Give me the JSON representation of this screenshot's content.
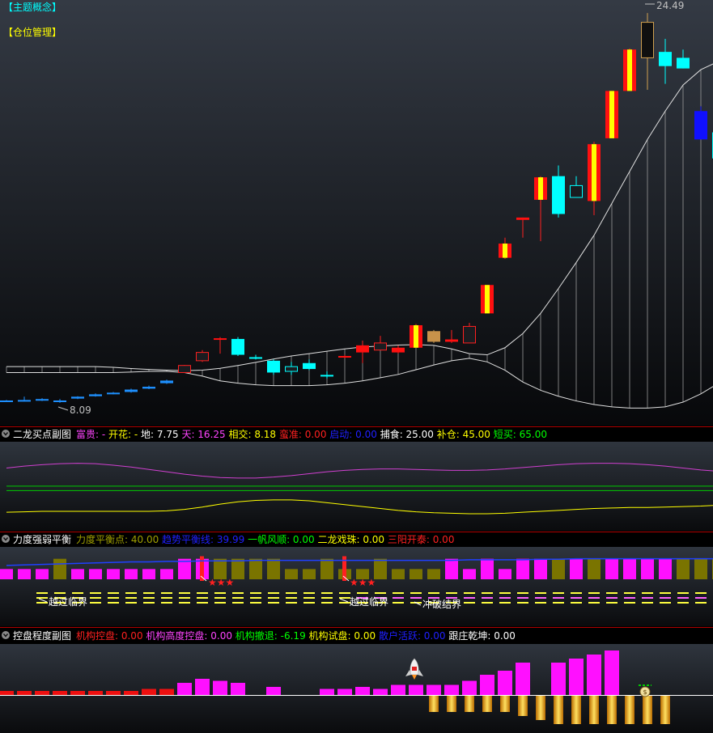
{
  "main": {
    "tag1": "【主题概念】",
    "tag2": "【仓位管理】",
    "high_label": "24.49",
    "low_label": "8.09"
  },
  "panel1": {
    "title": "二龙买点副图",
    "items": [
      {
        "label": "富贵: -",
        "color": "#ff44ff"
      },
      {
        "label": "开花: -",
        "color": "#ffff00"
      },
      {
        "label": "地: 7.75",
        "color": "#ffffff"
      },
      {
        "label": "天: 16.25",
        "color": "#ff44ff"
      },
      {
        "label": "相交: 8.18",
        "color": "#ffff00"
      },
      {
        "label": "蛮准: 0.00",
        "color": "#ff2020"
      },
      {
        "label": "启动: 0.00",
        "color": "#2020ff"
      },
      {
        "label": "捕食: 25.00",
        "color": "#ffffff"
      },
      {
        "label": "补仓: 45.00",
        "color": "#ffff00"
      },
      {
        "label": "短买: 65.00",
        "color": "#00ff00"
      }
    ]
  },
  "panel2": {
    "title": "力度强弱平衡",
    "items": [
      {
        "label": "力度平衡点: 40.00",
        "color": "#a0a000"
      },
      {
        "label": "趋势平衡线: 39.99",
        "color": "#2020ff"
      },
      {
        "label": "一帆风顺: 0.00",
        "color": "#00ff00"
      },
      {
        "label": "二龙戏珠: 0.00",
        "color": "#ffff00"
      },
      {
        "label": "三阳开泰: 0.00",
        "color": "#ff2020"
      }
    ],
    "annotations": [
      "越过临界",
      "越过临界",
      "冲破结界"
    ],
    "stars": "★★★"
  },
  "panel3": {
    "title": "控盘程度副图",
    "items": [
      {
        "label": "机构控盘: 0.00",
        "color": "#ff2020"
      },
      {
        "label": "机构高度控盘: 0.00",
        "color": "#ff44ff"
      },
      {
        "label": "机构撤退: -6.19",
        "color": "#00ff00"
      },
      {
        "label": "机构试盘: 0.00",
        "color": "#ffff00"
      },
      {
        "label": "散户活跃: 0.00",
        "color": "#2020ff"
      },
      {
        "label": "跟庄乾坤: 0.00",
        "color": "#ffffff"
      }
    ]
  },
  "chart_data": [
    {
      "type": "candlestick",
      "candles": [
        {
          "o": 8.12,
          "c": 8.1,
          "h": 8.14,
          "l": 8.06,
          "t": "dn"
        },
        {
          "o": 8.14,
          "c": 8.12,
          "h": 8.28,
          "l": 8.08,
          "t": "dn"
        },
        {
          "o": 8.15,
          "c": 8.18,
          "h": 8.22,
          "l": 8.1,
          "t": "dn"
        },
        {
          "o": 8.12,
          "c": 8.1,
          "h": 8.18,
          "l": 8.02,
          "t": "dn"
        },
        {
          "o": 8.2,
          "c": 8.28,
          "h": 8.3,
          "l": 8.18,
          "t": "dn"
        },
        {
          "o": 8.3,
          "c": 8.38,
          "h": 8.42,
          "l": 8.28,
          "t": "dn"
        },
        {
          "o": 8.4,
          "c": 8.45,
          "h": 8.48,
          "l": 8.38,
          "t": "dn"
        },
        {
          "o": 8.48,
          "c": 8.58,
          "h": 8.62,
          "l": 8.45,
          "t": "dn"
        },
        {
          "o": 8.62,
          "c": 8.7,
          "h": 8.75,
          "l": 8.6,
          "t": "dn"
        },
        {
          "o": 8.85,
          "c": 8.96,
          "h": 9.0,
          "l": 8.82,
          "t": "dn"
        },
        {
          "o": 9.3,
          "c": 9.6,
          "h": 9.62,
          "l": 9.28,
          "t": "up"
        },
        {
          "o": 9.8,
          "c": 10.15,
          "h": 10.25,
          "l": 9.75,
          "t": "up"
        },
        {
          "o": 10.7,
          "c": 10.75,
          "h": 10.8,
          "l": 10.1,
          "t": "fill"
        },
        {
          "o": 10.72,
          "c": 10.05,
          "h": 10.8,
          "l": 10.0,
          "t": "cy"
        },
        {
          "o": 9.95,
          "c": 9.9,
          "h": 10.05,
          "l": 9.85,
          "t": "cy"
        },
        {
          "o": 9.8,
          "c": 9.3,
          "h": 9.85,
          "l": 9.2,
          "t": "cy"
        },
        {
          "o": 9.35,
          "c": 9.55,
          "h": 9.75,
          "l": 9.2,
          "t": "ucy"
        },
        {
          "o": 9.45,
          "c": 9.7,
          "h": 9.85,
          "l": 9.4,
          "t": "cy"
        },
        {
          "o": 9.15,
          "c": 9.2,
          "h": 9.35,
          "l": 9.05,
          "t": "cy"
        },
        {
          "o": 9.95,
          "c": 10.0,
          "h": 10.05,
          "l": 9.9,
          "t": "fill"
        },
        {
          "o": 10.15,
          "c": 10.45,
          "h": 10.65,
          "l": 9.7,
          "t": "fill"
        },
        {
          "o": 10.25,
          "c": 10.55,
          "h": 10.85,
          "l": 10.25,
          "t": "up"
        },
        {
          "o": 10.15,
          "c": 10.35,
          "h": 10.45,
          "l": 10.1,
          "t": "fill"
        },
        {
          "o": 10.35,
          "c": 11.3,
          "h": 11.35,
          "l": 10.35,
          "t": "rs"
        },
        {
          "o": 10.6,
          "c": 11.05,
          "h": 11.1,
          "l": 10.55,
          "t": "tan"
        },
        {
          "o": 10.6,
          "c": 10.7,
          "h": 11.1,
          "l": 10.55,
          "t": "fill"
        },
        {
          "o": 10.55,
          "c": 11.25,
          "h": 11.4,
          "l": 10.55,
          "t": "up"
        },
        {
          "o": 11.8,
          "c": 13.0,
          "h": 13.0,
          "l": 11.8,
          "t": "rs"
        },
        {
          "o": 14.15,
          "c": 14.75,
          "h": 15.0,
          "l": 14.1,
          "t": "rs"
        },
        {
          "o": 15.75,
          "c": 15.85,
          "h": 15.85,
          "l": 15.0,
          "t": "fill"
        },
        {
          "o": 16.6,
          "c": 17.55,
          "h": 17.6,
          "l": 14.85,
          "t": "rs"
        },
        {
          "o": 17.6,
          "c": 16.0,
          "h": 18.05,
          "l": 15.85,
          "t": "cy"
        },
        {
          "o": 16.7,
          "c": 17.2,
          "h": 17.6,
          "l": 16.7,
          "t": "ucy"
        },
        {
          "o": 16.55,
          "c": 18.95,
          "h": 19.05,
          "l": 15.95,
          "t": "rs"
        },
        {
          "o": 19.2,
          "c": 21.2,
          "h": 21.2,
          "l": 19.2,
          "t": "rs"
        },
        {
          "o": 21.2,
          "c": 22.95,
          "h": 23.0,
          "l": 21.2,
          "t": "rs"
        },
        {
          "o": 22.6,
          "c": 24.1,
          "h": 24.49,
          "l": 21.25,
          "t": "blk"
        },
        {
          "o": 22.85,
          "c": 22.25,
          "h": 23.4,
          "l": 21.5,
          "t": "cy"
        },
        {
          "o": 22.6,
          "c": 22.15,
          "h": 22.95,
          "l": 22.15,
          "t": "cy"
        },
        {
          "o": 20.35,
          "c": 19.15,
          "h": 20.55,
          "l": 19.15,
          "t": "bl"
        },
        {
          "o": 19.45,
          "c": 18.35,
          "h": 19.5,
          "l": 18.3,
          "t": "cy"
        }
      ],
      "band_upper": [
        9.55,
        9.55,
        9.55,
        9.55,
        9.55,
        9.55,
        9.52,
        9.47,
        9.43,
        9.4,
        9.38,
        9.4,
        9.48,
        9.6,
        9.73,
        9.87,
        10.0,
        10.1,
        10.2,
        10.3,
        10.38,
        10.42,
        10.46,
        10.48,
        10.45,
        10.3,
        10.1,
        10.05,
        10.35,
        10.95,
        11.8,
        12.85,
        13.95,
        15.1,
        16.45,
        17.8,
        19.15,
        20.35,
        21.45,
        22.1,
        22.45
      ],
      "band_lower": [
        9.3,
        9.3,
        9.3,
        9.3,
        9.3,
        9.3,
        9.3,
        9.32,
        9.35,
        9.35,
        9.3,
        9.15,
        8.95,
        8.85,
        8.78,
        8.75,
        8.75,
        8.75,
        8.78,
        8.85,
        8.95,
        9.08,
        9.22,
        9.42,
        9.62,
        9.8,
        9.9,
        9.75,
        9.4,
        8.9,
        8.55,
        8.3,
        8.1,
        7.95,
        7.85,
        7.8,
        7.8,
        7.85,
        8.05,
        8.4,
        8.85
      ]
    },
    {
      "type": "line",
      "series": [
        {
          "name": "天",
          "color": "#d040d0",
          "values": [
            12.5,
            12.9,
            13.2,
            13.4,
            13.5,
            13.4,
            13.1,
            12.7,
            12.2,
            11.7,
            11.2,
            10.8,
            10.5,
            10.4,
            10.4,
            10.6,
            10.9,
            11.3,
            11.7,
            12.0,
            12.2,
            12.3,
            12.3,
            12.2,
            12.1,
            12.0,
            12.0,
            12.1,
            12.3,
            12.6,
            12.9,
            13.2,
            13.4,
            13.5,
            13.5,
            13.4,
            13.2,
            12.9,
            12.5,
            12.1,
            11.8
          ]
        },
        {
          "name": "地",
          "color": "#ffff00",
          "values": [
            3.2,
            3.3,
            3.4,
            3.4,
            3.4,
            3.4,
            3.4,
            3.4,
            3.4,
            3.5,
            3.8,
            4.3,
            4.9,
            5.4,
            5.7,
            5.8,
            5.8,
            5.6,
            5.2,
            4.8,
            4.4,
            4.0,
            3.6,
            3.3,
            3.1,
            3.0,
            2.9,
            2.9,
            3.0,
            3.2,
            3.4,
            3.6,
            3.8,
            4.0,
            4.1,
            4.2,
            4.2,
            4.3,
            4.4,
            4.5,
            4.7
          ]
        }
      ],
      "hlines": [
        {
          "value": 8.7,
          "color": "#00cc00"
        },
        {
          "value": 7.75,
          "color": "#00cc00"
        }
      ],
      "ylim": [
        0,
        17
      ]
    },
    {
      "type": "bar",
      "values": [
        20,
        20,
        20,
        40,
        20,
        20,
        20,
        20,
        20,
        20,
        40,
        40,
        40,
        40,
        40,
        40,
        20,
        20,
        40,
        20,
        20,
        40,
        20,
        20,
        20,
        40,
        20,
        40,
        20,
        40,
        40,
        40,
        40,
        40,
        40,
        40,
        40,
        40,
        40,
        40,
        40
      ],
      "colors": [
        "mg",
        "mg",
        "mg",
        "ol",
        "mg",
        "mg",
        "mg",
        "mg",
        "mg",
        "mg",
        "mg",
        "mg",
        "ol",
        "ol",
        "ol",
        "ol",
        "ol",
        "ol",
        "ol",
        "ol",
        "ol",
        "ol",
        "ol",
        "ol",
        "ol",
        "mg",
        "mg",
        "mg",
        "mg",
        "mg",
        "mg",
        "ol",
        "mg",
        "ol",
        "mg",
        "mg",
        "mg",
        "mg",
        "ol",
        "ol",
        "ol"
      ],
      "trend": [
        27,
        28,
        29,
        30,
        31,
        32,
        33,
        34,
        34,
        35,
        35,
        36,
        36,
        36,
        37,
        37,
        37,
        37,
        37,
        37,
        37,
        37,
        37,
        37,
        37,
        37,
        38,
        38,
        38,
        38,
        39,
        39,
        40,
        40,
        40,
        40,
        40,
        40,
        40,
        40,
        40
      ],
      "red_marks": [
        11,
        19
      ],
      "ylim": [
        0,
        60
      ]
    },
    {
      "type": "bar",
      "positive": [
        2,
        2,
        2,
        2,
        2,
        2,
        2,
        2,
        3,
        3,
        6,
        8,
        7,
        6,
        0,
        4,
        0,
        0,
        3,
        3,
        4,
        3,
        5,
        5,
        5,
        5,
        7,
        10,
        12,
        16,
        0,
        16,
        18,
        20,
        22,
        0,
        0,
        0,
        0,
        0,
        0
      ],
      "positive_colors": [
        "rd",
        "rd",
        "rd",
        "rd",
        "rd",
        "rd",
        "rd",
        "rd",
        "rd",
        "rd",
        "mg",
        "mg",
        "mg",
        "mg",
        "mg",
        "mg",
        "mg",
        "mg",
        "mg",
        "mg",
        "mg",
        "mg",
        "mg",
        "mg",
        "mg",
        "mg",
        "mg",
        "mg",
        "mg",
        "mg",
        "mg",
        "mg",
        "mg",
        "mg",
        "mg",
        "mg",
        "mg",
        "mg",
        "mg",
        "mg",
        "mg"
      ],
      "negative": [
        0,
        0,
        0,
        0,
        0,
        0,
        0,
        0,
        0,
        0,
        0,
        0,
        0,
        0,
        0,
        0,
        0,
        0,
        0,
        0,
        0,
        0,
        0,
        0,
        -8,
        -8,
        -8,
        -8,
        -8,
        -10,
        -12,
        -14,
        -14,
        -14,
        -14,
        -14,
        -14,
        -14,
        0,
        0,
        0
      ],
      "ylim": [
        -16,
        24
      ]
    }
  ]
}
